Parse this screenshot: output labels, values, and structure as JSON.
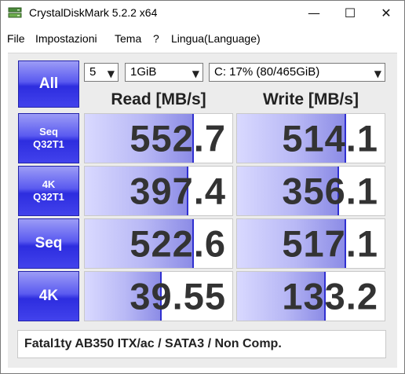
{
  "window": {
    "title": "CrystalDiskMark 5.2.2 x64",
    "controls": {
      "minimize": "—",
      "maximize": "☐",
      "close": "✕"
    }
  },
  "menu": [
    "File",
    "Impostazioni",
    "Tema",
    "?",
    "Lingua(Language)"
  ],
  "toolbar": {
    "all_label": "All",
    "count_value": "5",
    "size_value": "1GiB",
    "drive_value": "C: 17% (80/465GiB)"
  },
  "headers": {
    "read": "Read [MB/s]",
    "write": "Write [MB/s]"
  },
  "rows": [
    {
      "label": "Seq\nQ32T1",
      "read": "552.7",
      "write": "514.1",
      "read_level": 0.74,
      "write_level": 0.74
    },
    {
      "label": "4K\nQ32T1",
      "read": "397.4",
      "write": "356.1",
      "read_level": 0.7,
      "write_level": 0.69
    },
    {
      "label": "Seq",
      "read": "522.6",
      "write": "517.1",
      "read_level": 0.74,
      "write_level": 0.74
    },
    {
      "label": "4K",
      "read": "39.55",
      "write": "133.2",
      "read_level": 0.52,
      "write_level": 0.6
    }
  ],
  "comment": "Fatal1ty AB350 ITX/ac / SATA3 / Non Comp.",
  "colors": {
    "accent": "#3a3ae8",
    "bar_fill": "#b8b8f5",
    "value_text": "#333333"
  }
}
